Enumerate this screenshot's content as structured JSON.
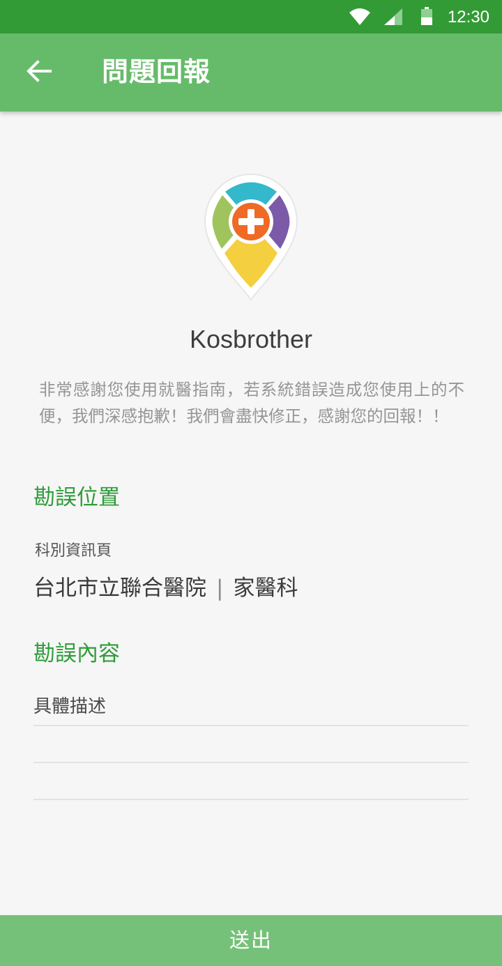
{
  "status_bar": {
    "time": "12:30",
    "icons": [
      "wifi-icon",
      "cell-signal-icon",
      "battery-icon"
    ],
    "color": "#339b35"
  },
  "app_bar": {
    "title": "問題回報",
    "back_icon": "arrow-left-icon",
    "color": "#66bb6a"
  },
  "logo": {
    "icon": "map-pin-medical-plus-logo",
    "colors": {
      "top": "#33b8cc",
      "right": "#7b5aa8",
      "left": "#9fc45e",
      "bottom": "#f4cf3f",
      "center": "#ee6a25"
    }
  },
  "app_name": "Kosbrother",
  "thanks_message": "非常感謝您使用就醫指南，若系統錯誤造成您使用上的不便，我們深感抱歉！我們會盡快修正，感謝您的回報！！",
  "error_location": {
    "section_title": "勘誤位置",
    "page_label": "科別資訊頁",
    "hospital": "台北市立聯合醫院",
    "separator": "|",
    "department": "家醫科"
  },
  "error_content": {
    "section_title": "勘誤內容",
    "description_placeholder": "具體描述"
  },
  "submit_label": "送出",
  "accent_colors": {
    "section_title": "#2f9c3a",
    "submit_button": "#76c179"
  }
}
